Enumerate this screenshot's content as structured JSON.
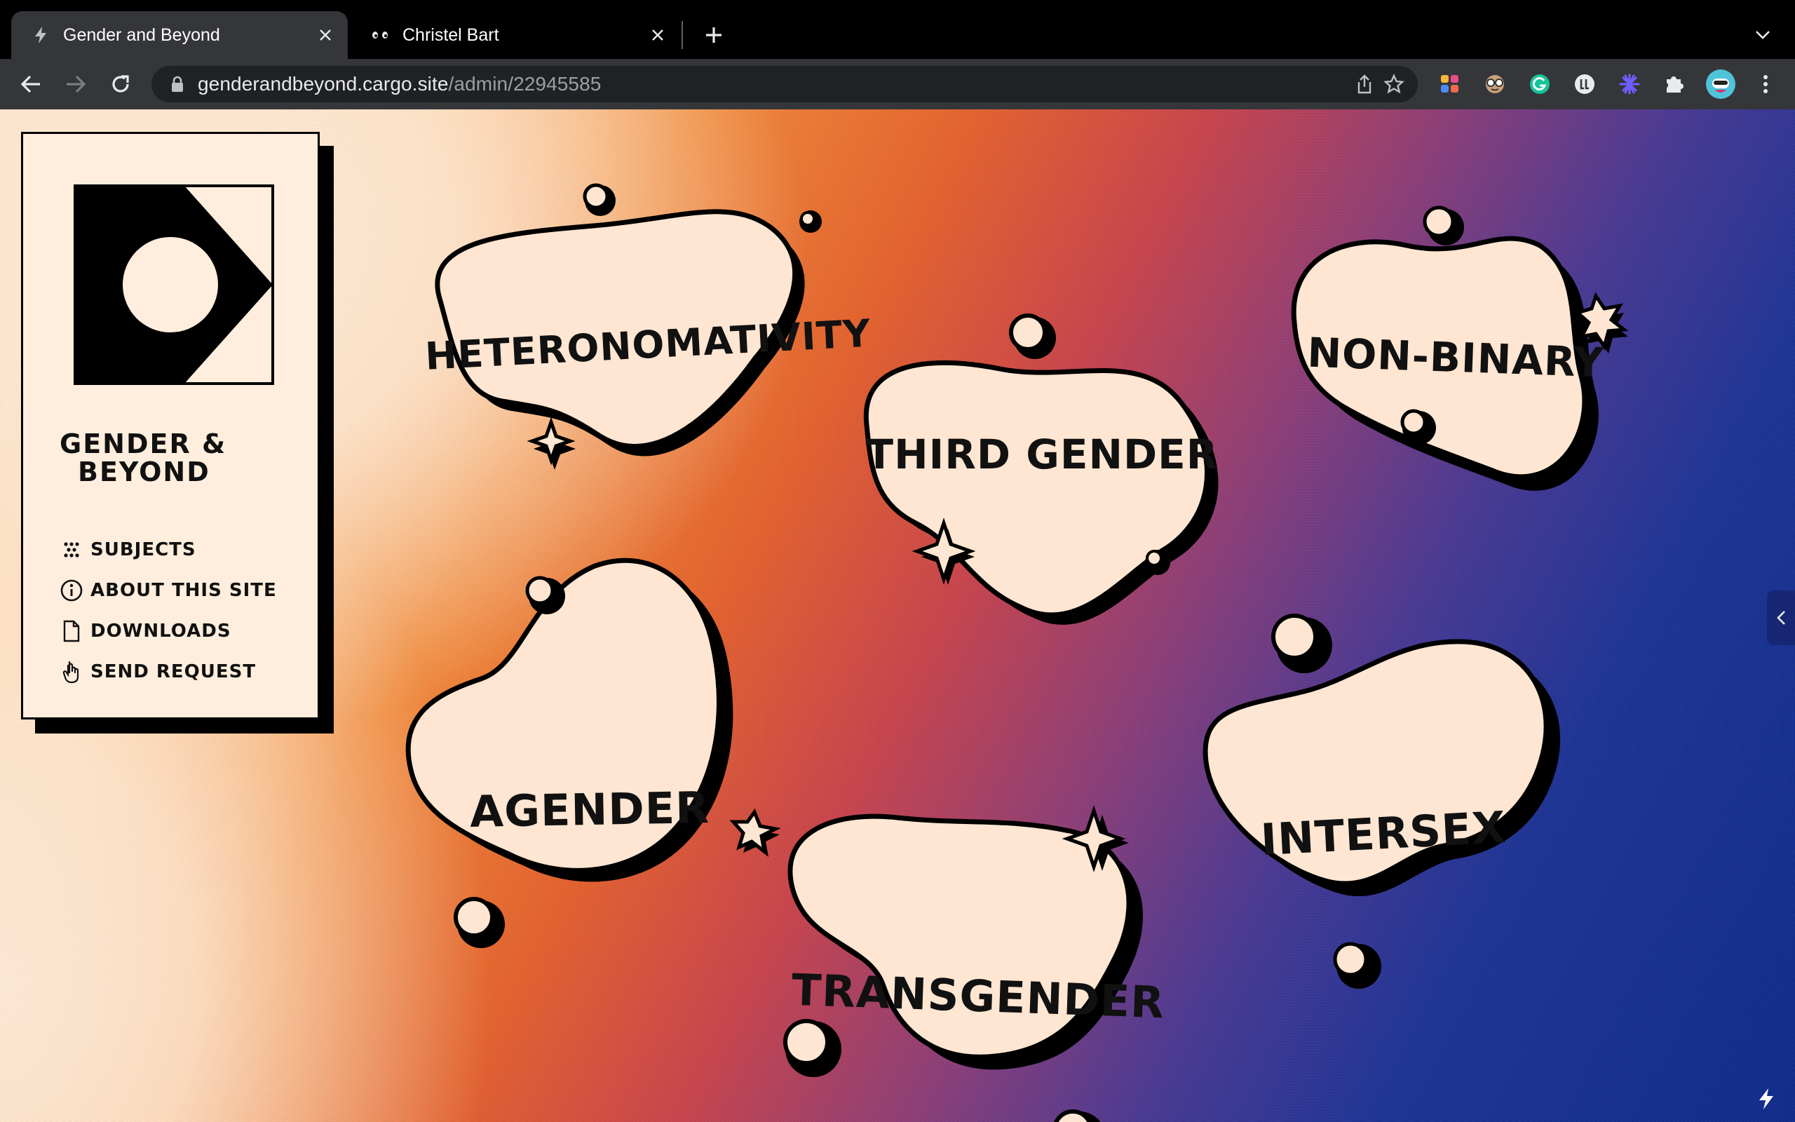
{
  "browser": {
    "tabs": [
      {
        "title": "Gender and Beyond",
        "icon": "bolt-icon",
        "active": true
      },
      {
        "title": "Christel Bart",
        "icon": "eyes-icon",
        "active": false
      }
    ],
    "url_host": "genderandbeyond.cargo.site",
    "url_path": "/admin/22945585"
  },
  "sidebar": {
    "brand_line1": "Gender &",
    "brand_line2": "Beyond",
    "menu": [
      {
        "label": "Subjects",
        "icon": "dice-icon"
      },
      {
        "label": "About this site",
        "icon": "info-icon"
      },
      {
        "label": "Downloads",
        "icon": "document-icon"
      },
      {
        "label": "Send request",
        "icon": "hand-pointer-icon"
      }
    ]
  },
  "subjects": {
    "heteronormativity": "Heteronomativity",
    "third_gender": "Third Gender",
    "non_binary": "Non-Binary",
    "agender": "Agender",
    "intersex": "Intersex",
    "transgender": "Transgender"
  },
  "colors": {
    "chrome_dark": "#35363a",
    "bubble_fill": "#ffe6d2",
    "ink": "#111111",
    "gradient": [
      "#ffe0bd",
      "#f28a3a",
      "#c9454d",
      "#4a3a94",
      "#112c8c"
    ]
  }
}
